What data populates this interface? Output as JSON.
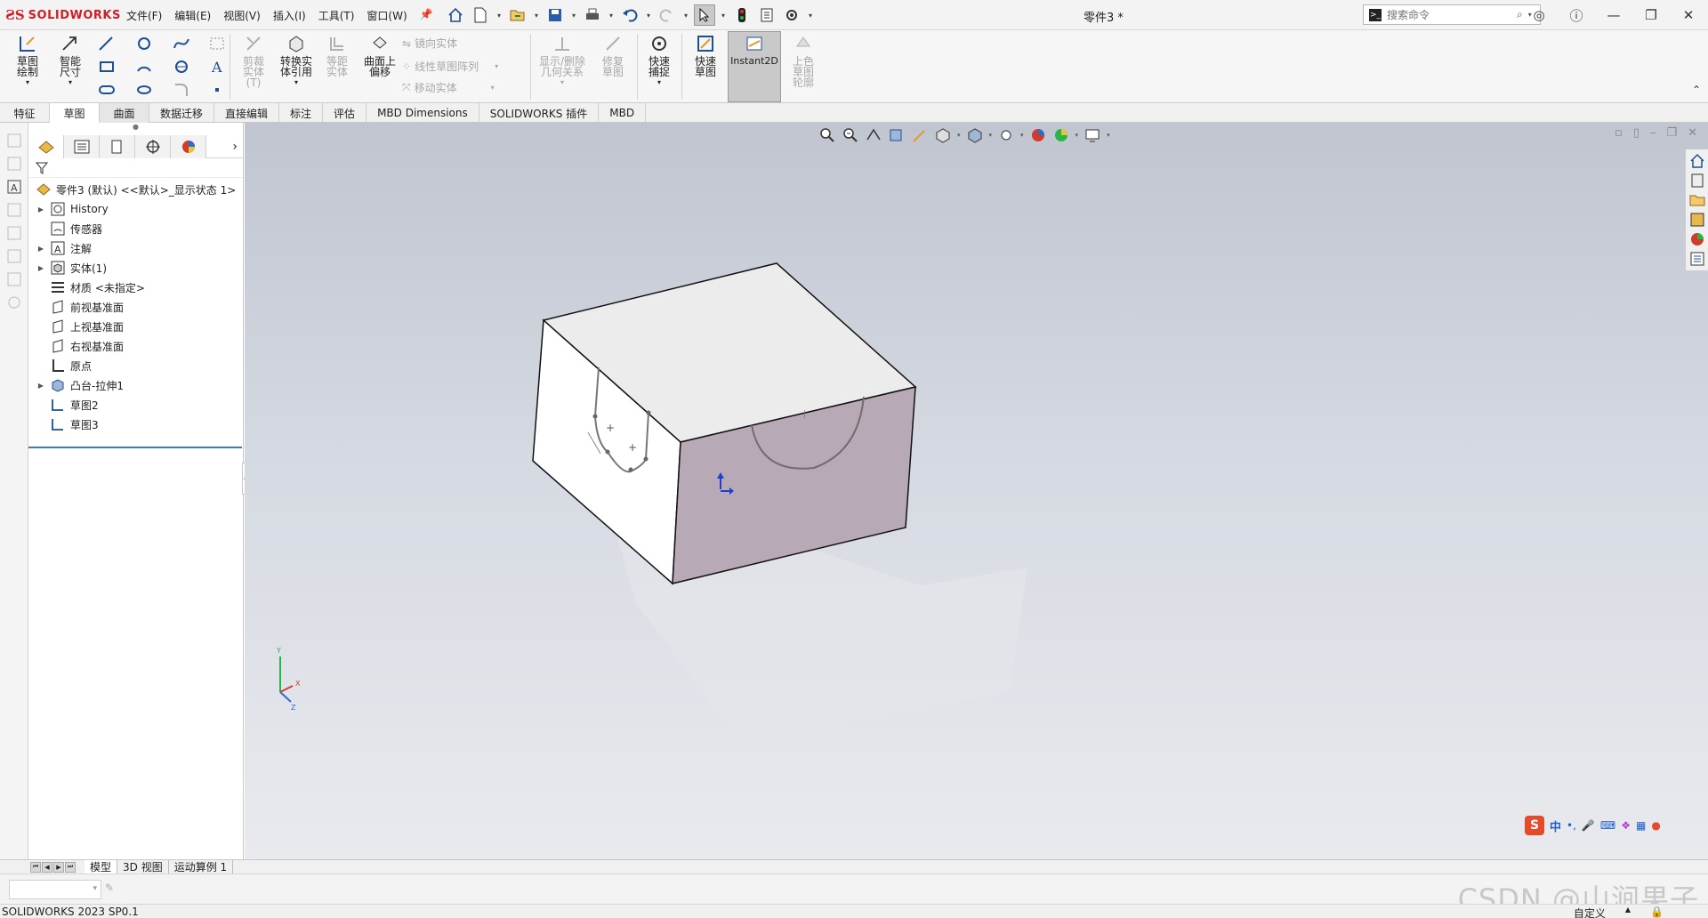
{
  "app": {
    "logo_text": "SOLIDWORKS",
    "document_title": "零件3 *"
  },
  "menu": [
    "文件(F)",
    "编辑(E)",
    "视图(V)",
    "插入(I)",
    "工具(T)",
    "窗口(W)"
  ],
  "search": {
    "placeholder": "搜索命令"
  },
  "ribbon": {
    "sketch": "草图绘制",
    "smart_dim": "智能尺寸",
    "trim": "剪裁实体(T)",
    "convert": "转换实体引用",
    "offset": "等距实体",
    "offset_surface": "曲面上偏移",
    "mirror": "镜向实体",
    "linear_pattern": "线性草图阵列",
    "move": "移动实体",
    "show_relations": "显示/删除几何关系",
    "repair": "修复草图",
    "quick_snap": "快速捕捉",
    "rapid_sketch": "快速草图",
    "instant2d": "Instant2D",
    "shaded_sketch": "上色草图轮廓"
  },
  "command_tabs": [
    {
      "label": "特征",
      "state": "normal"
    },
    {
      "label": "草图",
      "state": "active"
    },
    {
      "label": "曲面",
      "state": "dim"
    },
    {
      "label": "数据迁移",
      "state": "normal"
    },
    {
      "label": "直接编辑",
      "state": "normal"
    },
    {
      "label": "标注",
      "state": "normal"
    },
    {
      "label": "评估",
      "state": "normal"
    },
    {
      "label": "MBD Dimensions",
      "state": "normal"
    },
    {
      "label": "SOLIDWORKS 插件",
      "state": "normal"
    },
    {
      "label": "MBD",
      "state": "normal"
    }
  ],
  "tree": {
    "root": "零件3 (默认) <<默认>_显示状态 1>",
    "items": [
      {
        "label": "History",
        "icon": "history-icon",
        "expandable": true
      },
      {
        "label": "传感器",
        "icon": "sensor-icon",
        "expandable": false
      },
      {
        "label": "注解",
        "icon": "annotation-icon",
        "expandable": true
      },
      {
        "label": "实体(1)",
        "icon": "solid-body-icon",
        "expandable": true
      },
      {
        "label": "材质 <未指定>",
        "icon": "material-icon",
        "expandable": false
      },
      {
        "label": "前视基准面",
        "icon": "plane-icon",
        "expandable": false
      },
      {
        "label": "上视基准面",
        "icon": "plane-icon",
        "expandable": false
      },
      {
        "label": "右视基准面",
        "icon": "plane-icon",
        "expandable": false
      },
      {
        "label": "原点",
        "icon": "origin-icon",
        "expandable": false
      },
      {
        "label": "凸台-拉伸1",
        "icon": "extrude-icon",
        "expandable": true
      },
      {
        "label": "草图2",
        "icon": "sketch-icon",
        "expandable": false
      },
      {
        "label": "草图3",
        "icon": "sketch-icon",
        "expandable": false
      }
    ]
  },
  "triad": {
    "x": "X",
    "y": "Y",
    "z": "Z"
  },
  "bottom_tabs": [
    {
      "label": "模型",
      "active": true
    },
    {
      "label": "3D 视图",
      "active": false
    },
    {
      "label": "运动算例 1",
      "active": false
    }
  ],
  "ime": {
    "lang": "中"
  },
  "watermark": "CSDN @山涧果子",
  "status": {
    "version": "SOLIDWORKS 2023 SP0.1",
    "custom": "自定义",
    "arrow": "▲"
  },
  "colors": {
    "brand": "#d11f26",
    "selected_face": "#b8a9b6",
    "highlight": "#3c7ac6"
  }
}
